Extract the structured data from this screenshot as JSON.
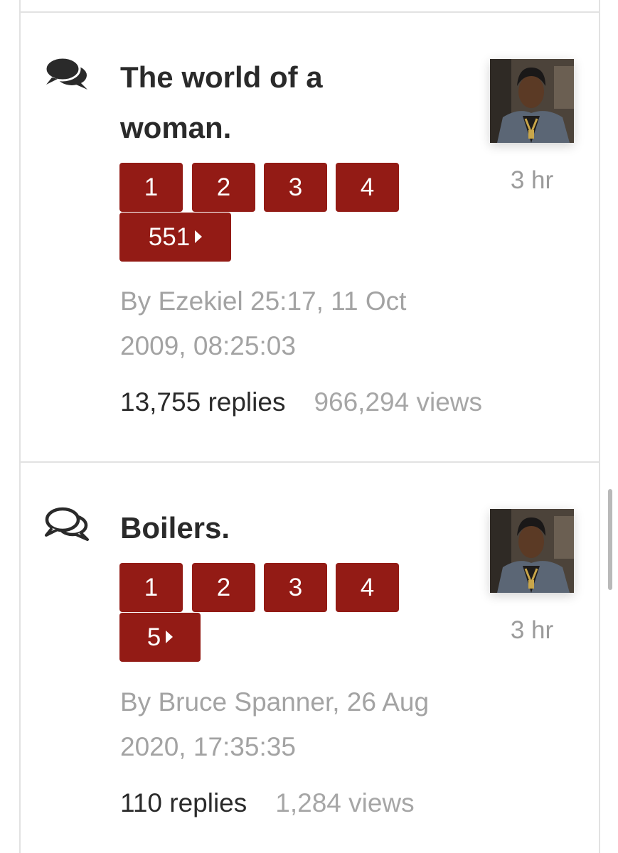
{
  "threads": [
    {
      "title": "The world of a woman.",
      "pages": [
        "1",
        "2",
        "3",
        "4",
        "551"
      ],
      "byline": "By Ezekiel 25:17, 11 Oct 2009, 08:25:03",
      "replies": "13,755 replies",
      "views": "966,294 views",
      "last_post_age": "3 hr",
      "icon": "chat-bubbles-filled-icon"
    },
    {
      "title": "Boilers.",
      "pages": [
        "1",
        "2",
        "3",
        "4",
        "5"
      ],
      "byline": "By Bruce Spanner, 26 Aug 2020, 17:35:35",
      "replies": "110 replies",
      "views": "1,284 views",
      "last_post_age": "3 hr",
      "icon": "chat-bubbles-outline-icon"
    }
  ],
  "colors": {
    "page_button": "#931b15",
    "title_text": "#2a2a2a",
    "muted_text": "#a3a3a3",
    "divider": "#e2e2e2"
  }
}
